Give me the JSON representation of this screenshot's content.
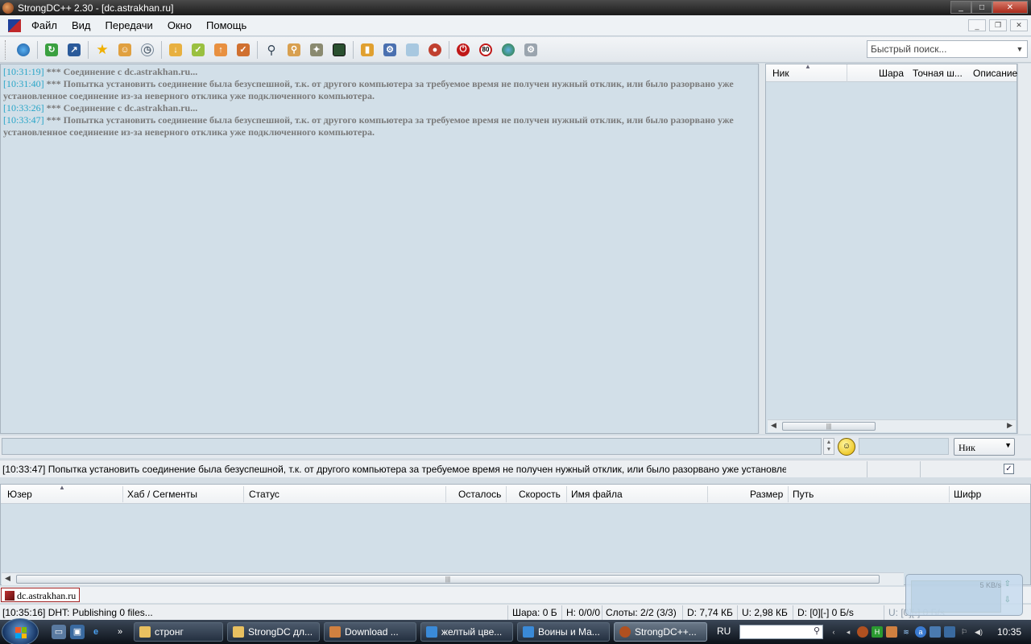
{
  "window": {
    "title": "StrongDC++ 2.30 - [dc.astrakhan.ru]",
    "controls": [
      "_",
      "□",
      "✕"
    ]
  },
  "menu": {
    "items": [
      "Файл",
      "Вид",
      "Передачи",
      "Окно",
      "Помощь"
    ]
  },
  "toolbar": {
    "icons": [
      "globe-icon",
      "refresh-icon",
      "redirect-icon",
      "favorites-star-icon",
      "favorite-users-icon",
      "recent-hubs-icon",
      "download-queue-icon",
      "finished-downloads-icon",
      "upload-queue-icon",
      "finished-uploads-icon",
      "search-icon",
      "adl-search-icon",
      "search-spy-icon",
      "notepad-icon",
      "open-file-list-icon",
      "settings-icon",
      "network-stats-icon",
      "cdm-debug-icon",
      "shutdown-icon",
      "limiter-80-icon",
      "hash-progress-icon",
      "system-log-icon"
    ],
    "quick_search_placeholder": "Быстрый поиск..."
  },
  "chat": {
    "lines": [
      {
        "ts": "[10:31:19]",
        "text": " *** Соединение с dc.astrakhan.ru..."
      },
      {
        "ts": "[10:31:40]",
        "text": " *** Попытка установить соединение была безуспешной, т.к. от другого компьютера за требуемое время не получен нужный отклик, или было разорвано уже установленное соединение из-за неверного отклика уже подключенного компьютера."
      },
      {
        "ts": "[10:33:26]",
        "text": " *** Соединение с dc.astrakhan.ru..."
      },
      {
        "ts": "[10:33:47]",
        "text": " *** Попытка установить соединение была безуспешной, т.к. от другого компьютера за требуемое время не получен нужный отклик, или было разорвано уже установленное соединение из-за неверного отклика уже подключенного компьютера."
      }
    ]
  },
  "userlist": {
    "columns": [
      "Ник",
      "Шара",
      "Точная ш...",
      "Описание"
    ]
  },
  "input": {
    "nick_select": "Ник"
  },
  "status_line": {
    "text": "[10:33:47] Попытка установить соединение была безуспешной, т.к. от другого компьютера за требуемое время не получен нужный отклик, или было разорвано уже установле",
    "checked": true
  },
  "transfers": {
    "columns": [
      "Юзер",
      "Хаб / Сегменты",
      "Статус",
      "Осталось",
      "Скорость",
      "Имя файла",
      "Размер",
      "Путь",
      "Шифр"
    ]
  },
  "tabs": [
    {
      "label": "dc.astrakhan.ru"
    }
  ],
  "statusbar": {
    "message": "[10:35:16] DHT: Publishing 0 files...",
    "share": "Шара: 0 Б",
    "hubs": "H: 0/0/0",
    "slots": "Слоты: 2/2 (3/3)",
    "downloaded": "D: 7,74 КБ",
    "uploaded": "U: 2,98 КБ",
    "down_speed": "D: [0][-] 0 Б/s",
    "up_speed": "U: [0][-] 0 Б/s"
  },
  "speed_popup": {
    "label": "5 KB/s"
  },
  "taskbar": {
    "tasks": [
      {
        "label": "стронг",
        "icon": "folder-icon",
        "color": "#e8c060"
      },
      {
        "label": "StrongDC дл...",
        "icon": "folder-icon",
        "color": "#e8c060"
      },
      {
        "label": "Download ...",
        "icon": "download-icon",
        "color": "#d08040"
      },
      {
        "label": "желтый цве...",
        "icon": "ie-icon",
        "color": "#3a8ad8"
      },
      {
        "label": "Воины и Ма...",
        "icon": "ie-icon",
        "color": "#3a8ad8"
      },
      {
        "label": "StrongDC++...",
        "icon": "strongdc-icon",
        "color": "#b05020"
      }
    ],
    "lang": "RU",
    "clock": "10:35"
  }
}
